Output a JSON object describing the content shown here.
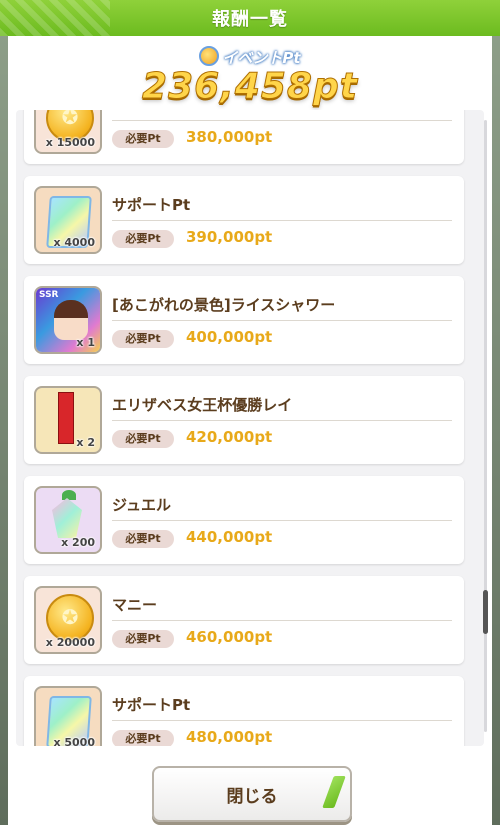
{
  "header": {
    "title": "報酬一覧"
  },
  "event": {
    "label": "イベントPt",
    "total": "236,458pt"
  },
  "rewards": [
    {
      "name": "",
      "qty": "x 15000",
      "req_label": "必要Pt",
      "req_pt": "380,000pt",
      "icon": "money-coin-icon"
    },
    {
      "name": "サポートPt",
      "qty": "x 4000",
      "req_label": "必要Pt",
      "req_pt": "390,000pt",
      "icon": "support-pt-card-icon"
    },
    {
      "name": "[あこがれの景色]ライスシャワー",
      "qty": "x 1",
      "req_label": "必要Pt",
      "req_pt": "400,000pt",
      "icon": "ssr-character-card-icon",
      "tag": "SSR"
    },
    {
      "name": "エリザベス女王杯優勝レイ",
      "qty": "x 2",
      "req_label": "必要Pt",
      "req_pt": "420,000pt",
      "icon": "victory-sash-icon"
    },
    {
      "name": "ジュエル",
      "qty": "x 200",
      "req_label": "必要Pt",
      "req_pt": "440,000pt",
      "icon": "jewel-icon"
    },
    {
      "name": "マニー",
      "qty": "x 20000",
      "req_label": "必要Pt",
      "req_pt": "460,000pt",
      "icon": "money-coin-icon"
    },
    {
      "name": "サポートPt",
      "qty": "x 5000",
      "req_label": "必要Pt",
      "req_pt": "480,000pt",
      "icon": "support-pt-card-icon"
    }
  ],
  "footer": {
    "close_label": "閉じる"
  }
}
